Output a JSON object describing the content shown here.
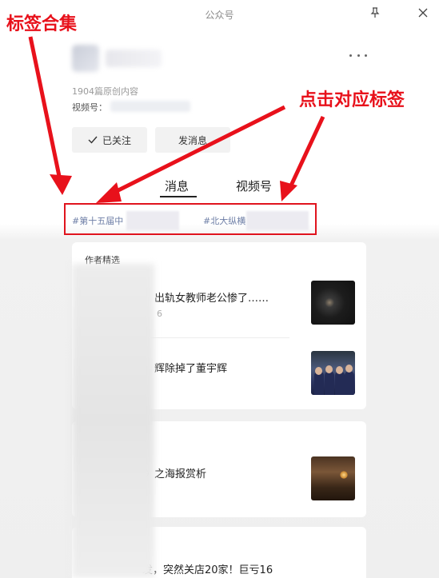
{
  "window": {
    "title": "公众号"
  },
  "profile": {
    "original_count": "1904篇原创内容",
    "video_id_label": "视频号：",
    "follow_label": "已关注",
    "message_label": "发消息"
  },
  "tabs": [
    {
      "label": "消息",
      "active": true
    },
    {
      "label": "视频号",
      "active": false
    }
  ],
  "tags": [
    {
      "label": "#第十五届中"
    },
    {
      "label": "#北大纵横"
    }
  ],
  "feed": {
    "section_label": "作者精选",
    "articles": [
      {
        "title": "出轨女教师老公惨了……",
        "meta": "6"
      },
      {
        "title": "辉除掉了董宇辉",
        "meta": ""
      },
      {
        "title": "》之海报赏析",
        "meta": ""
      },
      {
        "title": "发，突然关店20家！巨亏16",
        "meta": ""
      }
    ]
  },
  "annotations": {
    "left_label": "标签合集",
    "right_label": "点击对应标签",
    "color": "#e8111b"
  },
  "colors": {
    "tag_text": "#6d7ea6",
    "highlight_box": "#e0141e"
  }
}
